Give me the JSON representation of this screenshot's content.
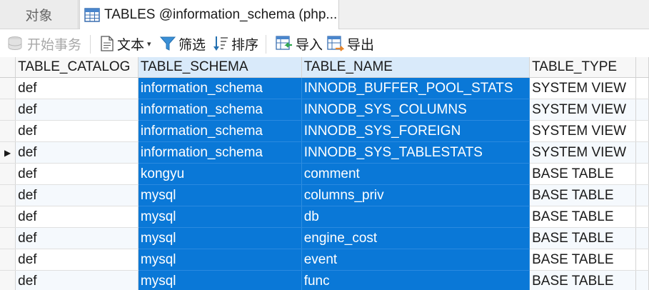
{
  "tabs": {
    "objects_label": "对象",
    "active_label": "TABLES @information_schema (php..."
  },
  "toolbar": {
    "begin_transaction": "开始事务",
    "text": "文本",
    "filter": "筛选",
    "sort": "排序",
    "import": "导入",
    "export": "导出"
  },
  "grid": {
    "columns": [
      "TABLE_CATALOG",
      "TABLE_SCHEMA",
      "TABLE_NAME",
      "TABLE_TYPE"
    ],
    "current_row_marker": "▶",
    "rows": [
      [
        "def",
        "information_schema",
        "INNODB_BUFFER_POOL_STATS",
        "SYSTEM VIEW"
      ],
      [
        "def",
        "information_schema",
        "INNODB_SYS_COLUMNS",
        "SYSTEM VIEW"
      ],
      [
        "def",
        "information_schema",
        "INNODB_SYS_FOREIGN",
        "SYSTEM VIEW"
      ],
      [
        "def",
        "information_schema",
        "INNODB_SYS_TABLESTATS",
        "SYSTEM VIEW"
      ],
      [
        "def",
        "kongyu",
        "comment",
        "BASE TABLE"
      ],
      [
        "def",
        "mysql",
        "columns_priv",
        "BASE TABLE"
      ],
      [
        "def",
        "mysql",
        "db",
        "BASE TABLE"
      ],
      [
        "def",
        "mysql",
        "engine_cost",
        "BASE TABLE"
      ],
      [
        "def",
        "mysql",
        "event",
        "BASE TABLE"
      ],
      [
        "def",
        "mysql",
        "func",
        "BASE TABLE"
      ]
    ],
    "current_row_index": 3,
    "selected_columns": [
      1,
      2
    ],
    "selection_color": "#0a78d7"
  }
}
